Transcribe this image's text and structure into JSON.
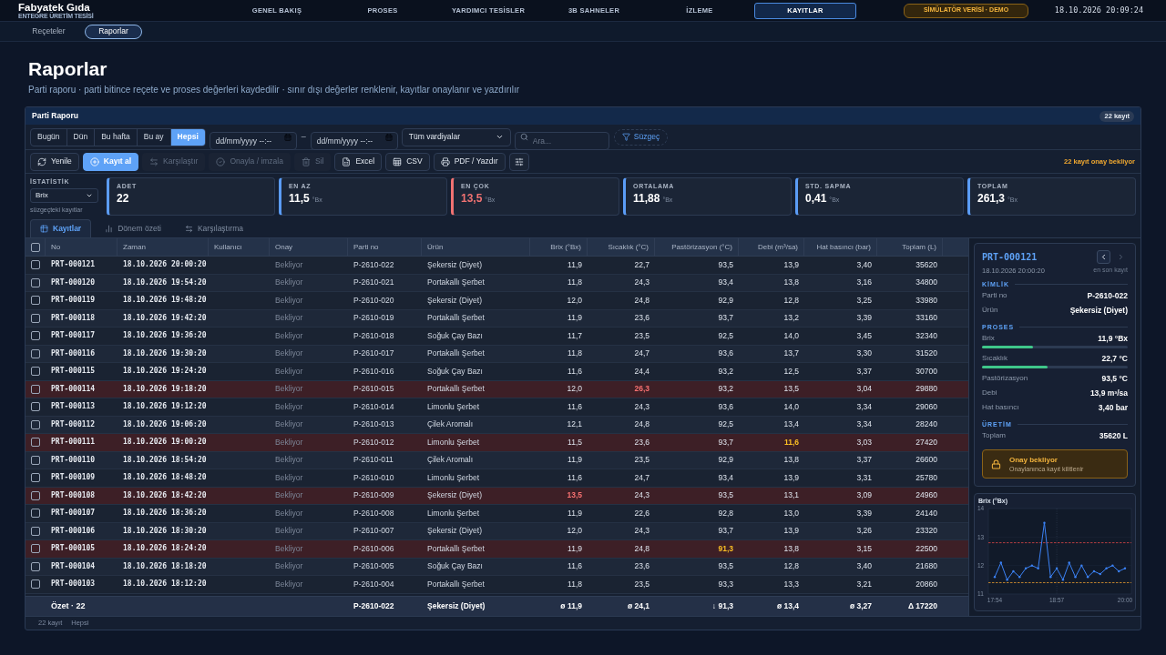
{
  "brand": {
    "name": "Fabyatek Gıda",
    "subtitle": "ENTEGRE ÜRETİM TESİSİ"
  },
  "nav": [
    {
      "label": "GENEL BAKIŞ",
      "selected": false
    },
    {
      "label": "PROSES",
      "selected": false
    },
    {
      "label": "YARDIMCI TESİSLER",
      "selected": false
    },
    {
      "label": "3B SAHNELER",
      "selected": false
    },
    {
      "label": "İZLEME",
      "selected": false
    },
    {
      "label": "KAYITLAR",
      "selected": true
    }
  ],
  "mode_badge": "SİMÜLATÖR VERİSİ · DEMO",
  "clock": "18.10.2026 20:09:24",
  "subnav": [
    {
      "label": "Reçeteler",
      "selected": false
    },
    {
      "label": "Raporlar",
      "selected": true
    }
  ],
  "page": {
    "title": "Raporlar",
    "subtitle": "Parti raporu · parti bitince reçete ve proses değerleri kaydedilir · sınır dışı değerler renklenir, kayıtlar onaylanır ve yazdırılır"
  },
  "panel": {
    "title": "Parti Raporu",
    "count_badge": "22 kayıt"
  },
  "filters": {
    "periods": [
      {
        "label": "Bugün",
        "selected": false
      },
      {
        "label": "Dün",
        "selected": false
      },
      {
        "label": "Bu hafta",
        "selected": false
      },
      {
        "label": "Bu ay",
        "selected": false
      },
      {
        "label": "Hepsi",
        "selected": true
      }
    ],
    "date_from": {
      "placeholder": "dd/mm/yyyy --:--"
    },
    "date_separator": "–",
    "date_to": {
      "placeholder": "dd/mm/yyyy --:--"
    },
    "shift": {
      "value": "Tüm vardiyalar"
    },
    "search": {
      "placeholder": "Ara..."
    },
    "filter_button": "Süzgeç"
  },
  "actions": [
    {
      "kind": "default",
      "label": "Yenile",
      "disabled": false
    },
    {
      "kind": "primary",
      "label": "Kayıt al",
      "disabled": false
    },
    {
      "kind": "default",
      "label": "Karşılaştır",
      "disabled": true
    },
    {
      "kind": "default",
      "label": "Onayla / imzala",
      "disabled": true
    },
    {
      "kind": "default",
      "label": "Sil",
      "disabled": true
    },
    {
      "kind": "default",
      "label": "Excel",
      "disabled": false
    },
    {
      "kind": "default",
      "label": "CSV",
      "disabled": false
    },
    {
      "kind": "default",
      "label": "PDF / Yazdır",
      "disabled": false
    },
    {
      "kind": "icon",
      "disabled": false
    }
  ],
  "pending_note": "22 kayıt onay bekliyor",
  "statistics": {
    "label": "İSTATİSTİK",
    "metric": {
      "value": "Brix"
    },
    "hint": "süzgeçteki kayıtlar",
    "cards": [
      {
        "label": "ADET",
        "value": "22",
        "color": "#5b9cf6",
        "value_tinted": false
      },
      {
        "label": "EN AZ",
        "value": "11,5",
        "unit": "°Bx",
        "color": "#5b9cf6",
        "value_tinted": false
      },
      {
        "label": "EN ÇOK",
        "value": "13,5",
        "unit": "°Bx",
        "color": "#f07272",
        "value_tinted": true
      },
      {
        "label": "ORTALAMA",
        "value": "11,88",
        "unit": "°Bx",
        "color": "#5b9cf6",
        "value_tinted": false
      },
      {
        "label": "STD. SAPMA",
        "value": "0,41",
        "unit": "°Bx",
        "color": "#5b9cf6",
        "value_tinted": false
      },
      {
        "label": "TOPLAM",
        "value": "261,3",
        "unit": "°Bx",
        "color": "#5b9cf6",
        "value_tinted": false
      }
    ]
  },
  "tabs": [
    {
      "label": "Kayıtlar",
      "selected": true
    },
    {
      "label": "Dönem özeti",
      "selected": false
    },
    {
      "label": "Karşılaştırma",
      "selected": false
    }
  ],
  "table": {
    "all_checked": false,
    "columns": [
      "No",
      "Zaman",
      "Kullanıcı",
      "Onay",
      "Parti no",
      "Ürün",
      "Brix (°Bx)",
      "Sıcaklık (°C)",
      "Pastörizasyon (°C)",
      "Debi (m³/sa)",
      "Hat basıncı (bar)",
      "Toplam (L)"
    ],
    "rows": [
      {
        "checked": false,
        "alarm": false,
        "no": "PRT-000121",
        "time": "18.10.2026 20:00:20",
        "approval": "Bekliyor",
        "batch": "P-2610-022",
        "product": "Şekersiz (Diyet)",
        "values": [
          {
            "text": "11,9",
            "critical": false,
            "warning": false
          },
          {
            "text": "22,7",
            "critical": false,
            "warning": false
          },
          {
            "text": "93,5",
            "critical": false,
            "warning": false
          },
          {
            "text": "13,9",
            "critical": false,
            "warning": false
          },
          {
            "text": "3,40",
            "critical": false,
            "warning": false
          },
          {
            "text": "35620",
            "critical": false,
            "warning": false
          }
        ]
      },
      {
        "checked": false,
        "alarm": false,
        "no": "PRT-000120",
        "time": "18.10.2026 19:54:20",
        "approval": "Bekliyor",
        "batch": "P-2610-021",
        "product": "Portakallı Şerbet",
        "values": [
          {
            "text": "11,8",
            "critical": false,
            "warning": false
          },
          {
            "text": "24,3",
            "critical": false,
            "warning": false
          },
          {
            "text": "93,4",
            "critical": false,
            "warning": false
          },
          {
            "text": "13,8",
            "critical": false,
            "warning": false
          },
          {
            "text": "3,16",
            "critical": false,
            "warning": false
          },
          {
            "text": "34800",
            "critical": false,
            "warning": false
          }
        ]
      },
      {
        "checked": false,
        "alarm": false,
        "no": "PRT-000119",
        "time": "18.10.2026 19:48:20",
        "approval": "Bekliyor",
        "batch": "P-2610-020",
        "product": "Şekersiz (Diyet)",
        "values": [
          {
            "text": "12,0",
            "critical": false,
            "warning": false
          },
          {
            "text": "24,8",
            "critical": false,
            "warning": false
          },
          {
            "text": "92,9",
            "critical": false,
            "warning": false
          },
          {
            "text": "12,8",
            "critical": false,
            "warning": false
          },
          {
            "text": "3,25",
            "critical": false,
            "warning": false
          },
          {
            "text": "33980",
            "critical": false,
            "warning": false
          }
        ]
      },
      {
        "checked": false,
        "alarm": false,
        "no": "PRT-000118",
        "time": "18.10.2026 19:42:20",
        "approval": "Bekliyor",
        "batch": "P-2610-019",
        "product": "Portakallı Şerbet",
        "values": [
          {
            "text": "11,9",
            "critical": false,
            "warning": false
          },
          {
            "text": "23,6",
            "critical": false,
            "warning": false
          },
          {
            "text": "93,7",
            "critical": false,
            "warning": false
          },
          {
            "text": "13,2",
            "critical": false,
            "warning": false
          },
          {
            "text": "3,39",
            "critical": false,
            "warning": false
          },
          {
            "text": "33160",
            "critical": false,
            "warning": false
          }
        ]
      },
      {
        "checked": false,
        "alarm": false,
        "no": "PRT-000117",
        "time": "18.10.2026 19:36:20",
        "approval": "Bekliyor",
        "batch": "P-2610-018",
        "product": "Soğuk Çay Bazı",
        "values": [
          {
            "text": "11,7",
            "critical": false,
            "warning": false
          },
          {
            "text": "23,5",
            "critical": false,
            "warning": false
          },
          {
            "text": "92,5",
            "critical": false,
            "warning": false
          },
          {
            "text": "14,0",
            "critical": false,
            "warning": false
          },
          {
            "text": "3,45",
            "critical": false,
            "warning": false
          },
          {
            "text": "32340",
            "critical": false,
            "warning": false
          }
        ]
      },
      {
        "checked": false,
        "alarm": false,
        "no": "PRT-000116",
        "time": "18.10.2026 19:30:20",
        "approval": "Bekliyor",
        "batch": "P-2610-017",
        "product": "Portakallı Şerbet",
        "values": [
          {
            "text": "11,8",
            "critical": false,
            "warning": false
          },
          {
            "text": "24,7",
            "critical": false,
            "warning": false
          },
          {
            "text": "93,6",
            "critical": false,
            "warning": false
          },
          {
            "text": "13,7",
            "critical": false,
            "warning": false
          },
          {
            "text": "3,30",
            "critical": false,
            "warning": false
          },
          {
            "text": "31520",
            "critical": false,
            "warning": false
          }
        ]
      },
      {
        "checked": false,
        "alarm": false,
        "no": "PRT-000115",
        "time": "18.10.2026 19:24:20",
        "approval": "Bekliyor",
        "batch": "P-2610-016",
        "product": "Soğuk Çay Bazı",
        "values": [
          {
            "text": "11,6",
            "critical": false,
            "warning": false
          },
          {
            "text": "24,4",
            "critical": false,
            "warning": false
          },
          {
            "text": "93,2",
            "critical": false,
            "warning": false
          },
          {
            "text": "12,5",
            "critical": false,
            "warning": false
          },
          {
            "text": "3,37",
            "critical": false,
            "warning": false
          },
          {
            "text": "30700",
            "critical": false,
            "warning": false
          }
        ]
      },
      {
        "checked": false,
        "alarm": true,
        "no": "PRT-000114",
        "time": "18.10.2026 19:18:20",
        "approval": "Bekliyor",
        "batch": "P-2610-015",
        "product": "Portakallı Şerbet",
        "values": [
          {
            "text": "12,0",
            "critical": false,
            "warning": false
          },
          {
            "text": "26,3",
            "critical": true,
            "warning": false
          },
          {
            "text": "93,2",
            "critical": false,
            "warning": false
          },
          {
            "text": "13,5",
            "critical": false,
            "warning": false
          },
          {
            "text": "3,04",
            "critical": false,
            "warning": false
          },
          {
            "text": "29880",
            "critical": false,
            "warning": false
          }
        ]
      },
      {
        "checked": false,
        "alarm": false,
        "no": "PRT-000113",
        "time": "18.10.2026 19:12:20",
        "approval": "Bekliyor",
        "batch": "P-2610-014",
        "product": "Limonlu Şerbet",
        "values": [
          {
            "text": "11,6",
            "critical": false,
            "warning": false
          },
          {
            "text": "24,3",
            "critical": false,
            "warning": false
          },
          {
            "text": "93,6",
            "critical": false,
            "warning": false
          },
          {
            "text": "14,0",
            "critical": false,
            "warning": false
          },
          {
            "text": "3,34",
            "critical": false,
            "warning": false
          },
          {
            "text": "29060",
            "critical": false,
            "warning": false
          }
        ]
      },
      {
        "checked": false,
        "alarm": false,
        "no": "PRT-000112",
        "time": "18.10.2026 19:06:20",
        "approval": "Bekliyor",
        "batch": "P-2610-013",
        "product": "Çilek Aromalı",
        "values": [
          {
            "text": "12,1",
            "critical": false,
            "warning": false
          },
          {
            "text": "24,8",
            "critical": false,
            "warning": false
          },
          {
            "text": "92,5",
            "critical": false,
            "warning": false
          },
          {
            "text": "13,4",
            "critical": false,
            "warning": false
          },
          {
            "text": "3,34",
            "critical": false,
            "warning": false
          },
          {
            "text": "28240",
            "critical": false,
            "warning": false
          }
        ]
      },
      {
        "checked": false,
        "alarm": true,
        "no": "PRT-000111",
        "time": "18.10.2026 19:00:20",
        "approval": "Bekliyor",
        "batch": "P-2610-012",
        "product": "Limonlu Şerbet",
        "values": [
          {
            "text": "11,5",
            "critical": false,
            "warning": false
          },
          {
            "text": "23,6",
            "critical": false,
            "warning": false
          },
          {
            "text": "93,7",
            "critical": false,
            "warning": false
          },
          {
            "text": "11,6",
            "critical": false,
            "warning": true
          },
          {
            "text": "3,03",
            "critical": false,
            "warning": false
          },
          {
            "text": "27420",
            "critical": false,
            "warning": false
          }
        ]
      },
      {
        "checked": false,
        "alarm": false,
        "no": "PRT-000110",
        "time": "18.10.2026 18:54:20",
        "approval": "Bekliyor",
        "batch": "P-2610-011",
        "product": "Çilek Aromalı",
        "values": [
          {
            "text": "11,9",
            "critical": false,
            "warning": false
          },
          {
            "text": "23,5",
            "critical": false,
            "warning": false
          },
          {
            "text": "92,9",
            "critical": false,
            "warning": false
          },
          {
            "text": "13,8",
            "critical": false,
            "warning": false
          },
          {
            "text": "3,37",
            "critical": false,
            "warning": false
          },
          {
            "text": "26600",
            "critical": false,
            "warning": false
          }
        ]
      },
      {
        "checked": false,
        "alarm": false,
        "no": "PRT-000109",
        "time": "18.10.2026 18:48:20",
        "approval": "Bekliyor",
        "batch": "P-2610-010",
        "product": "Limonlu Şerbet",
        "values": [
          {
            "text": "11,6",
            "critical": false,
            "warning": false
          },
          {
            "text": "24,7",
            "critical": false,
            "warning": false
          },
          {
            "text": "93,4",
            "critical": false,
            "warning": false
          },
          {
            "text": "13,9",
            "critical": false,
            "warning": false
          },
          {
            "text": "3,31",
            "critical": false,
            "warning": false
          },
          {
            "text": "25780",
            "critical": false,
            "warning": false
          }
        ]
      },
      {
        "checked": false,
        "alarm": true,
        "no": "PRT-000108",
        "time": "18.10.2026 18:42:20",
        "approval": "Bekliyor",
        "batch": "P-2610-009",
        "product": "Şekersiz (Diyet)",
        "values": [
          {
            "text": "13,5",
            "critical": true,
            "warning": false
          },
          {
            "text": "24,3",
            "critical": false,
            "warning": false
          },
          {
            "text": "93,5",
            "critical": false,
            "warning": false
          },
          {
            "text": "13,1",
            "critical": false,
            "warning": false
          },
          {
            "text": "3,09",
            "critical": false,
            "warning": false
          },
          {
            "text": "24960",
            "critical": false,
            "warning": false
          }
        ]
      },
      {
        "checked": false,
        "alarm": false,
        "no": "PRT-000107",
        "time": "18.10.2026 18:36:20",
        "approval": "Bekliyor",
        "batch": "P-2610-008",
        "product": "Limonlu Şerbet",
        "values": [
          {
            "text": "11,9",
            "critical": false,
            "warning": false
          },
          {
            "text": "22,6",
            "critical": false,
            "warning": false
          },
          {
            "text": "92,8",
            "critical": false,
            "warning": false
          },
          {
            "text": "13,0",
            "critical": false,
            "warning": false
          },
          {
            "text": "3,39",
            "critical": false,
            "warning": false
          },
          {
            "text": "24140",
            "critical": false,
            "warning": false
          }
        ]
      },
      {
        "checked": false,
        "alarm": false,
        "no": "PRT-000106",
        "time": "18.10.2026 18:30:20",
        "approval": "Bekliyor",
        "batch": "P-2610-007",
        "product": "Şekersiz (Diyet)",
        "values": [
          {
            "text": "12,0",
            "critical": false,
            "warning": false
          },
          {
            "text": "24,3",
            "critical": false,
            "warning": false
          },
          {
            "text": "93,7",
            "critical": false,
            "warning": false
          },
          {
            "text": "13,9",
            "critical": false,
            "warning": false
          },
          {
            "text": "3,26",
            "critical": false,
            "warning": false
          },
          {
            "text": "23320",
            "critical": false,
            "warning": false
          }
        ]
      },
      {
        "checked": false,
        "alarm": true,
        "no": "PRT-000105",
        "time": "18.10.2026 18:24:20",
        "approval": "Bekliyor",
        "batch": "P-2610-006",
        "product": "Portakallı Şerbet",
        "values": [
          {
            "text": "11,9",
            "critical": false,
            "warning": false
          },
          {
            "text": "24,8",
            "critical": false,
            "warning": false
          },
          {
            "text": "91,3",
            "critical": false,
            "warning": true
          },
          {
            "text": "13,8",
            "critical": false,
            "warning": false
          },
          {
            "text": "3,15",
            "critical": false,
            "warning": false
          },
          {
            "text": "22500",
            "critical": false,
            "warning": false
          }
        ]
      },
      {
        "checked": false,
        "alarm": false,
        "no": "PRT-000104",
        "time": "18.10.2026 18:18:20",
        "approval": "Bekliyor",
        "batch": "P-2610-005",
        "product": "Soğuk Çay Bazı",
        "values": [
          {
            "text": "11,6",
            "critical": false,
            "warning": false
          },
          {
            "text": "23,6",
            "critical": false,
            "warning": false
          },
          {
            "text": "93,5",
            "critical": false,
            "warning": false
          },
          {
            "text": "12,8",
            "critical": false,
            "warning": false
          },
          {
            "text": "3,40",
            "critical": false,
            "warning": false
          },
          {
            "text": "21680",
            "critical": false,
            "warning": false
          }
        ]
      },
      {
        "checked": false,
        "alarm": false,
        "no": "PRT-000103",
        "time": "18.10.2026 18:12:20",
        "approval": "Bekliyor",
        "batch": "P-2610-004",
        "product": "Portakallı Şerbet",
        "values": [
          {
            "text": "11,8",
            "critical": false,
            "warning": false
          },
          {
            "text": "23,5",
            "critical": false,
            "warning": false
          },
          {
            "text": "93,3",
            "critical": false,
            "warning": false
          },
          {
            "text": "13,3",
            "critical": false,
            "warning": false
          },
          {
            "text": "3,21",
            "critical": false,
            "warning": false
          },
          {
            "text": "20860",
            "critical": false,
            "warning": false
          }
        ]
      }
    ],
    "summary": {
      "label": "Özet · 22",
      "batch": "P-2610-022",
      "product": "Şekersiz (Diyet)",
      "values": [
        "ø 11,9",
        "ø 24,1",
        "↓ 91,3",
        "ø 13,4",
        "ø 3,27",
        "Δ 17220"
      ]
    }
  },
  "status_bar": {
    "count": "22 kayıt",
    "period": "Hepsi"
  },
  "detail": {
    "record": "PRT-000121",
    "previous_button": {
      "disabled": false
    },
    "next_button": {
      "disabled": true
    },
    "time": "18.10.2026 20:00:20",
    "note": "en son kayıt",
    "sections": [
      {
        "title": "KİMLİK",
        "fields": [
          {
            "kind": "plain",
            "label": "Parti no",
            "value": "P-2610-022"
          },
          {
            "kind": "plain",
            "label": "Ürün",
            "value": "Şekersiz (Diyet)"
          }
        ]
      },
      {
        "title": "PROSES",
        "fields": [
          {
            "kind": "meter",
            "label": "Brix",
            "value": "11,9 °Bx",
            "level": 0.35
          },
          {
            "kind": "meter",
            "label": "Sıcaklık",
            "value": "22,7 °C",
            "level": 0.45
          },
          {
            "kind": "plain",
            "label": "Pastörizasyon",
            "value": "93,5 °C"
          },
          {
            "kind": "plain",
            "label": "Debi",
            "value": "13,9 m³/sa"
          },
          {
            "kind": "plain",
            "label": "Hat basıncı",
            "value": "3,40 bar"
          }
        ]
      },
      {
        "title": "ÜRETİM",
        "fields": [
          {
            "kind": "plain",
            "label": "Toplam",
            "value": "35620 L"
          }
        ]
      }
    ],
    "alert": {
      "title": "Onay bekliyor",
      "text": "Onaylanınca kayıt kilitlenir"
    }
  },
  "trend": {
    "chart_data": {
      "type": "line",
      "title": "Brix (°Bx)",
      "categories": [
        "17:54",
        null,
        null,
        null,
        null,
        null,
        null,
        null,
        null,
        null,
        "18:57",
        null,
        null,
        null,
        null,
        null,
        null,
        null,
        null,
        null,
        null,
        "20:00"
      ],
      "series": [
        {
          "color": "#3b82f6",
          "values": [
            11.6,
            12.1,
            11.5,
            11.8,
            11.6,
            11.9,
            12.0,
            11.9,
            13.5,
            11.6,
            11.9,
            11.5,
            12.1,
            11.6,
            12.0,
            11.6,
            11.8,
            11.7,
            11.9,
            12.0,
            11.8,
            11.9
          ]
        }
      ],
      "ylim": [
        11,
        14
      ],
      "yticks": [
        11,
        12,
        13,
        14
      ],
      "ref_lines": [
        {
          "axis": "y",
          "value": 12.8,
          "color": "#e04848"
        },
        {
          "axis": "y",
          "value": 11.4,
          "color": "#f0a030"
        }
      ]
    }
  }
}
